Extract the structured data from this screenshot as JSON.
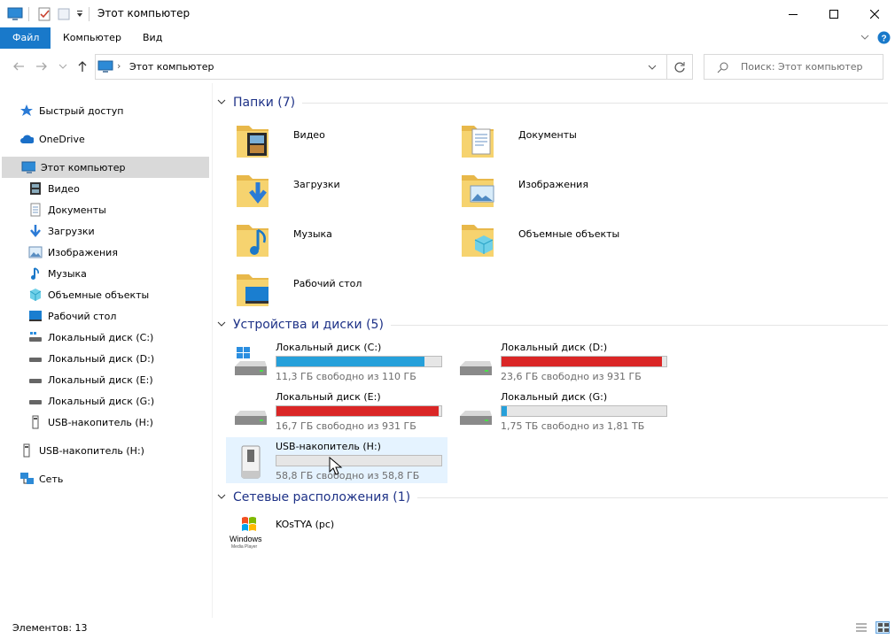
{
  "window": {
    "title": "Этот компьютер"
  },
  "ribbon": {
    "tabs": [
      {
        "label": "Файл",
        "active": true
      },
      {
        "label": "Компьютер",
        "active": false
      },
      {
        "label": "Вид",
        "active": false
      }
    ]
  },
  "address": {
    "path": "Этот компьютер",
    "search_placeholder": "Поиск: Этот компьютер"
  },
  "sidebar": {
    "items": [
      {
        "label": "Быстрый доступ",
        "icon": "star-icon"
      },
      {
        "label": "OneDrive",
        "icon": "cloud-icon"
      },
      {
        "label": "Этот компьютер",
        "icon": "computer-icon",
        "selected": true
      },
      {
        "label": "Видео",
        "icon": "video-icon"
      },
      {
        "label": "Документы",
        "icon": "document-icon"
      },
      {
        "label": "Загрузки",
        "icon": "download-icon"
      },
      {
        "label": "Изображения",
        "icon": "image-icon"
      },
      {
        "label": "Музыка",
        "icon": "music-icon"
      },
      {
        "label": "Объемные объекты",
        "icon": "cube-icon"
      },
      {
        "label": "Рабочий стол",
        "icon": "desktop-icon"
      },
      {
        "label": "Локальный диск (C:)",
        "icon": "drive-icon"
      },
      {
        "label": "Локальный диск (D:)",
        "icon": "drive-icon"
      },
      {
        "label": "Локальный диск (E:)",
        "icon": "drive-icon"
      },
      {
        "label": "Локальный диск (G:)",
        "icon": "drive-icon"
      },
      {
        "label": "USB-накопитель (H:)",
        "icon": "usb-icon"
      },
      {
        "label": "USB-накопитель (H:)",
        "icon": "usb-icon"
      },
      {
        "label": "Сеть",
        "icon": "network-icon"
      }
    ]
  },
  "groups": {
    "folders": {
      "title": "Папки (7)",
      "items": [
        {
          "label": "Видео",
          "icon": "video-folder-icon"
        },
        {
          "label": "Документы",
          "icon": "documents-folder-icon"
        },
        {
          "label": "Загрузки",
          "icon": "downloads-folder-icon"
        },
        {
          "label": "Изображения",
          "icon": "pictures-folder-icon"
        },
        {
          "label": "Музыка",
          "icon": "music-folder-icon"
        },
        {
          "label": "Объемные объекты",
          "icon": "3d-objects-folder-icon"
        },
        {
          "label": "Рабочий стол",
          "icon": "desktop-folder-icon"
        }
      ]
    },
    "drives": {
      "title": "Устройства и диски (5)",
      "items": [
        {
          "label": "Локальный диск (C:)",
          "size": "11,3 ГБ свободно из 110 ГБ",
          "used_fraction": 0.897,
          "color": "#26a0da",
          "icon": "system-drive-icon"
        },
        {
          "label": "Локальный диск (D:)",
          "size": "23,6 ГБ свободно из 931 ГБ",
          "used_fraction": 0.975,
          "color": "#da2626",
          "icon": "drive-icon"
        },
        {
          "label": "Локальный диск (E:)",
          "size": "16,7 ГБ свободно из 931 ГБ",
          "used_fraction": 0.982,
          "color": "#da2626",
          "icon": "drive-icon"
        },
        {
          "label": "Локальный диск (G:)",
          "size": "1,75 ТБ свободно из 1,81 ТБ",
          "used_fraction": 0.033,
          "color": "#26a0da",
          "icon": "drive-icon"
        },
        {
          "label": "USB-накопитель (H:)",
          "size": "58,8 ГБ свободно из 58,8 ГБ",
          "used_fraction": 0.0,
          "color": "#26a0da",
          "icon": "usb-drive-icon"
        }
      ]
    },
    "network": {
      "title": "Сетевые расположения (1)",
      "items": [
        {
          "label": "KOsTYA (pc)",
          "logo_text": "Windows",
          "logo_sub": "Media Player",
          "icon": "windows-media-player-icon"
        }
      ]
    }
  },
  "status": {
    "count": "Элементов: 13"
  }
}
